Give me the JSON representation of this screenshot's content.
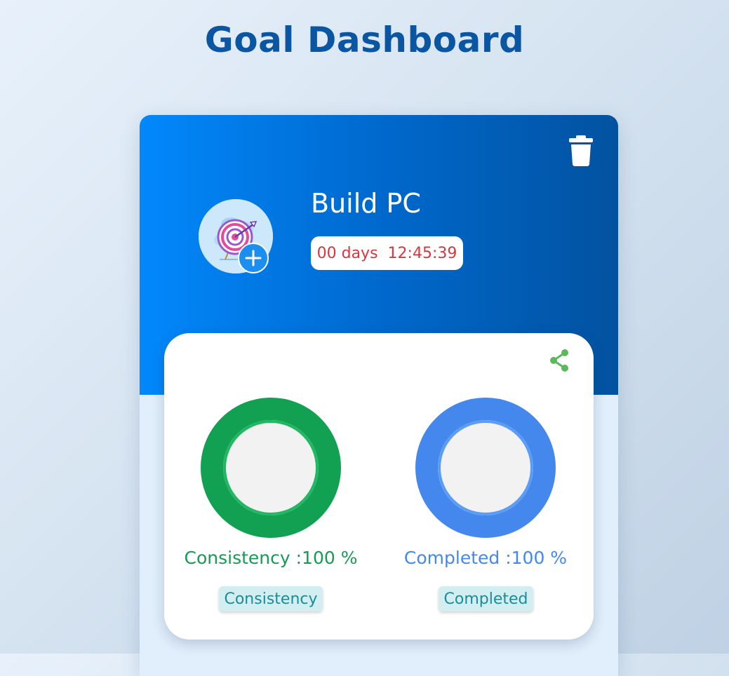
{
  "page": {
    "title": "Goal Dashboard"
  },
  "goal": {
    "name": "Build PC",
    "timer": {
      "days": "00 days",
      "time": "12:45:39"
    }
  },
  "stats": {
    "consistency": {
      "label": "Consistency :100 %",
      "percent": 100,
      "color": "#12a052",
      "chip": "Consistency"
    },
    "completed": {
      "label": "Completed :100 %",
      "percent": 100,
      "color": "#4488ee",
      "chip": "Completed"
    }
  },
  "icons": {
    "delete": "trash-icon",
    "share": "share-icon",
    "avatar": "target-arrow-icon",
    "add": "plus-icon"
  }
}
